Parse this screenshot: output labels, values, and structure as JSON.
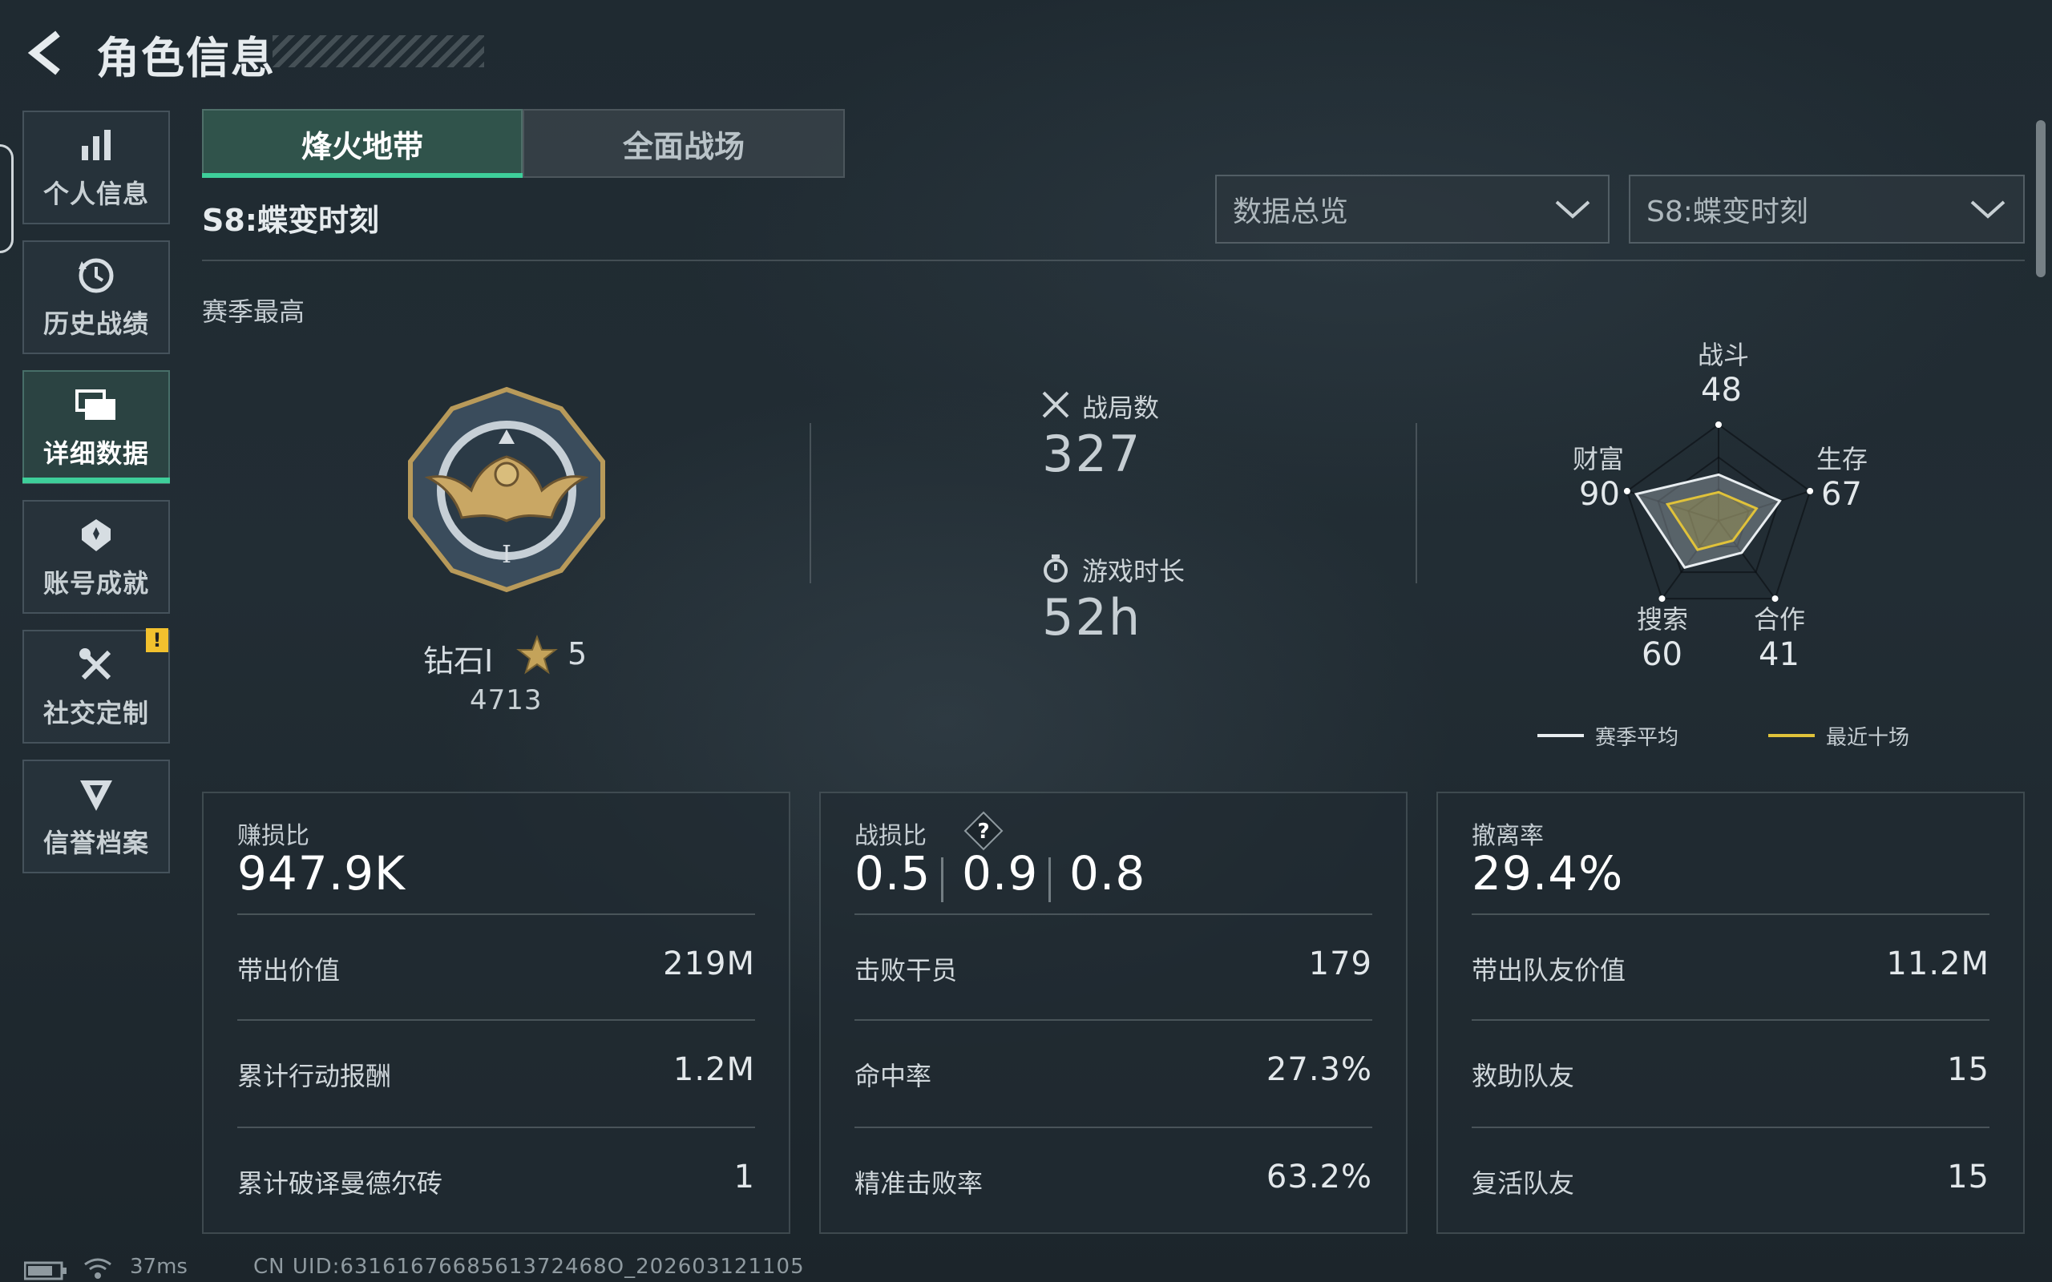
{
  "header": {
    "title": "角色信息"
  },
  "nav": {
    "items": [
      {
        "label": "个人信息",
        "icon": "bar-chart-icon"
      },
      {
        "label": "历史战绩",
        "icon": "history-clock-icon"
      },
      {
        "label": "详细数据",
        "icon": "folder-icon",
        "active": true
      },
      {
        "label": "账号成就",
        "icon": "achievement-icon"
      },
      {
        "label": "社交定制",
        "icon": "tools-icon",
        "badge": "!"
      },
      {
        "label": "信誉档案",
        "icon": "shield-credit-icon"
      }
    ]
  },
  "tabs": [
    {
      "label": "烽火地带",
      "active": true
    },
    {
      "label": "全面战场",
      "active": false
    }
  ],
  "season": {
    "title": "S8:蝶变时刻"
  },
  "filters": {
    "view": "数据总览",
    "season": "S8:蝶变时刻"
  },
  "best": {
    "label": "赛季最高"
  },
  "rank": {
    "name": "钻石Ⅰ",
    "stars": "5",
    "score": "4713"
  },
  "stats": {
    "matches_label": "战局数",
    "matches_value": "327",
    "time_label": "游戏时长",
    "time_value": "52h"
  },
  "radar": {
    "axes": [
      {
        "label": "战斗",
        "value": "48"
      },
      {
        "label": "生存",
        "value": "67"
      },
      {
        "label": "合作",
        "value": "41"
      },
      {
        "label": "搜索",
        "value": "60"
      },
      {
        "label": "财富",
        "value": "90"
      }
    ],
    "legend": [
      {
        "label": "赛季平均",
        "color": "#e8edf0"
      },
      {
        "label": "最近十场",
        "color": "#e0c23a"
      }
    ]
  },
  "cards": {
    "profit": {
      "label": "赚损比",
      "value": "947.9K",
      "rows": [
        {
          "label": "带出价值",
          "value": "219M"
        },
        {
          "label": "累计行动报酬",
          "value": "1.2M"
        },
        {
          "label": "累计破译曼德尔砖",
          "value": "1"
        }
      ]
    },
    "combat": {
      "label": "战损比",
      "help": "?",
      "values": [
        "0.5",
        "0.9",
        "0.8"
      ],
      "rows": [
        {
          "label": "击败干员",
          "value": "179"
        },
        {
          "label": "命中率",
          "value": "27.3%"
        },
        {
          "label": "精准击败率",
          "value": "63.2%"
        }
      ]
    },
    "extract": {
      "label": "撤离率",
      "value": "29.4%",
      "rows": [
        {
          "label": "带出队友价值",
          "value": "11.2M"
        },
        {
          "label": "救助队友",
          "value": "15"
        },
        {
          "label": "复活队友",
          "value": "15"
        }
      ]
    }
  },
  "status": {
    "ping": "37ms",
    "uid": "CN UID:6316167668561372468O_202603121105"
  }
}
